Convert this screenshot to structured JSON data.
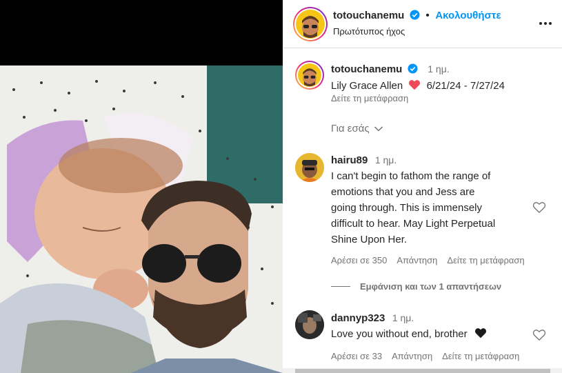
{
  "post": {
    "username": "totouchanemu",
    "follow_label": "Ακολουθήστε",
    "audio_label": "Πρωτότυπος ήχος"
  },
  "caption": {
    "username": "totouchanemu",
    "time": "1 ημ.",
    "text_before": "Lily Grace Allen",
    "text_after": "6/21/24 - 7/27/24",
    "translate": "Δείτε τη μετάφραση"
  },
  "for_you": "Για εσάς",
  "comments": [
    {
      "username": "hairu89",
      "time": "1 ημ.",
      "lines": [
        "I can't begin to fathom the range of",
        "emotions that you and Jess are",
        "going through. This is immensely",
        "difficult to hear. May Light Perpetual",
        "Shine Upon Her."
      ],
      "likes": "Αρέσει σε 350",
      "reply": "Απάντηση",
      "translate": "Δείτε τη μετάφραση"
    },
    {
      "username": "dannyp323",
      "time": "1 ημ.",
      "text": "Love you without end, brother",
      "likes": "Αρέσει σε 33",
      "reply": "Απάντηση",
      "translate": "Δείτε τη μετάφραση"
    }
  ],
  "view_replies": "Εμφάνιση και των 1 απαντήσεων",
  "colors": {
    "follow": "#0095f6",
    "verified": "#0095f6",
    "red_heart": "#ed4956",
    "muted": "#737373"
  },
  "icons": {
    "verified": "verified-badge-icon",
    "more": "more-options-icon",
    "like": "heart-outline-icon",
    "chevron": "chevron-down-icon"
  }
}
